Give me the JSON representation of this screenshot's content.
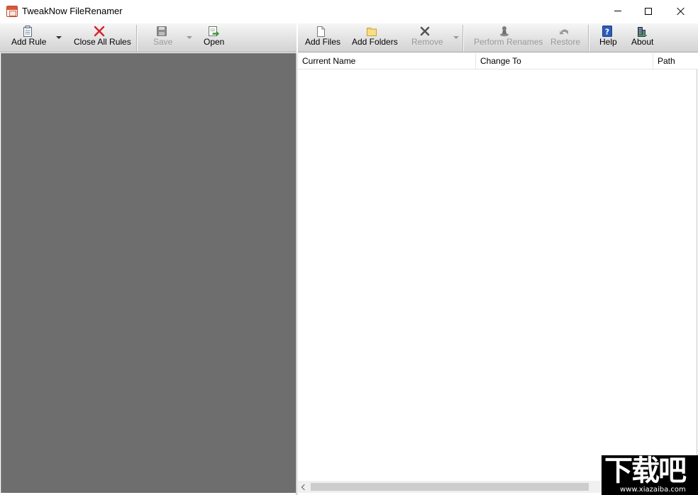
{
  "window": {
    "title": "TweakNow FileRenamer",
    "icon": "app-icon",
    "controls": [
      "minimize",
      "maximize",
      "close"
    ]
  },
  "left_toolbar": {
    "add_rule": "Add Rule",
    "close_all_rules": "Close All Rules",
    "save": "Save",
    "open": "Open"
  },
  "right_toolbar": {
    "add_files": "Add Files",
    "add_folders": "Add Folders",
    "remove": "Remove",
    "perform_renames": "Perform Renames",
    "restore": "Restore",
    "help": "Help",
    "about": "About"
  },
  "file_list": {
    "columns": [
      "Current Name",
      "Change To",
      "Path"
    ],
    "rows": []
  },
  "watermark": {
    "brand": "下载吧",
    "url": "www.xiazaiba.com"
  },
  "colors": {
    "rules_pane_bg": "#6e6e6e",
    "toolbar_gradient_top": "#f6f6f6",
    "toolbar_gradient_bottom": "#d3d3d3",
    "close_icon_red": "#d2242a",
    "disabled_text": "#9a9a9a"
  }
}
